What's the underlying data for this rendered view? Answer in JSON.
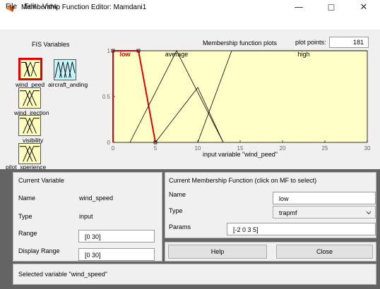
{
  "window": {
    "title": "Membership Function Editor: Mamdani1",
    "minimize_glyph": "—",
    "maximize_glyph": "☐",
    "close_glyph": "✕"
  },
  "menu": [
    "File",
    "Edit",
    "View"
  ],
  "fis_variables": {
    "title": "FIS Variables",
    "inputs": [
      {
        "label": "wind_peed"
      },
      {
        "label": "wind_irection"
      },
      {
        "label": "visibility"
      },
      {
        "label": "pilot_xperience"
      }
    ],
    "output": {
      "label": "aircraft_anding"
    }
  },
  "plot": {
    "title": "Membership function plots",
    "plot_points_label": "plot points:",
    "plot_points_value": "181",
    "xlabel": "input variable \"wind_peed\""
  },
  "chart_data": {
    "type": "line",
    "xlim": [
      0,
      30
    ],
    "ylim": [
      0,
      1
    ],
    "x_ticks": [
      "0",
      "5",
      "10",
      "15",
      "20",
      "25",
      "30"
    ],
    "y_ticks": [
      "0",
      "0.5",
      "1"
    ],
    "series": [
      {
        "name": "low",
        "shape": "trapmf",
        "points": [
          [
            -2,
            0
          ],
          [
            0,
            1
          ],
          [
            3,
            1
          ],
          [
            5,
            0
          ]
        ],
        "color": "#e00000",
        "selected": true
      },
      {
        "name": "average",
        "shape": "trimf",
        "points": [
          [
            2,
            0
          ],
          [
            7.5,
            1
          ],
          [
            13,
            0
          ]
        ],
        "color": "#000000"
      },
      {
        "name": "",
        "shape": "trimf",
        "points": [
          [
            5,
            0
          ],
          [
            10,
            0.6
          ],
          [
            13,
            0
          ]
        ],
        "color": "#000000"
      },
      {
        "name": "high",
        "shape": "trapmf",
        "points": [
          [
            10,
            0
          ],
          [
            14,
            1
          ],
          [
            30,
            1
          ],
          [
            32,
            1
          ]
        ],
        "color": "#000000"
      }
    ]
  },
  "current_variable": {
    "title": "Current Variable",
    "name_label": "Name",
    "name_value": "wind_speed",
    "type_label": "Type",
    "type_value": "input",
    "range_label": "Range",
    "range_value": "[0 30]",
    "display_range_label": "Display Range",
    "display_range_value": "[0 30]"
  },
  "current_mf": {
    "title": "Current Membership Function (click on MF to select)",
    "name_label": "Name",
    "name_value": "low",
    "type_label": "Type",
    "type_value": "trapmf",
    "params_label": "Params",
    "params_value": "[-2 0 3 5]"
  },
  "buttons": {
    "help": "Help",
    "close": "Close"
  },
  "status": "Selected variable \"wind_speed\"",
  "colors": {
    "plot_bg": "#ffffc8",
    "input_box": "#ffffbe",
    "output_box": "#c5f5fb",
    "selected": "#e00000",
    "panel_bg": "#646464"
  }
}
